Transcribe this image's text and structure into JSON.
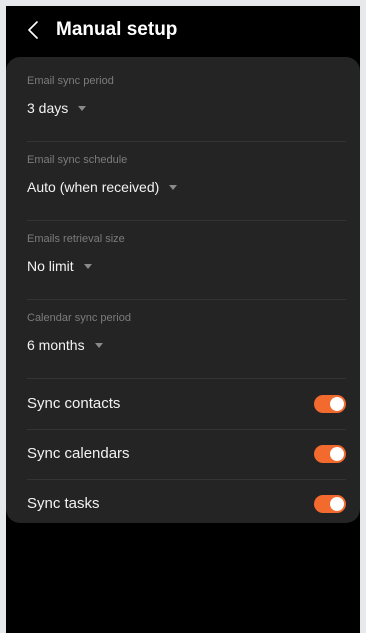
{
  "header": {
    "title": "Manual setup"
  },
  "dropdowns": [
    {
      "label": "Email sync period",
      "value": "3 days"
    },
    {
      "label": "Email sync schedule",
      "value": "Auto (when received)"
    },
    {
      "label": "Emails retrieval size",
      "value": "No limit"
    },
    {
      "label": "Calendar sync period",
      "value": "6 months"
    }
  ],
  "toggles": [
    {
      "label": "Sync contacts",
      "on": true
    },
    {
      "label": "Sync calendars",
      "on": true
    },
    {
      "label": "Sync tasks",
      "on": true
    }
  ],
  "colors": {
    "accent": "#f26a2e",
    "card": "#242424",
    "background": "#000000"
  },
  "icons": {
    "back": "chevron-left-icon",
    "dropdown": "caret-down-icon"
  }
}
